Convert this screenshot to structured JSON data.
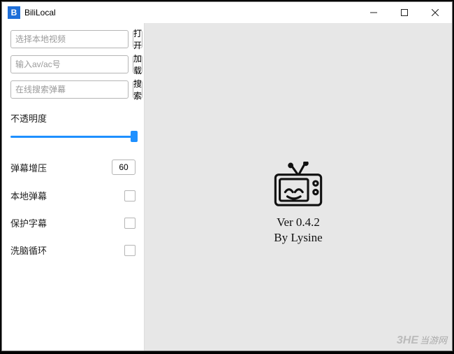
{
  "window": {
    "title": "BiliLocal",
    "app_icon_letter": "B"
  },
  "sidebar": {
    "video_input_placeholder": "选择本地视频",
    "open_label": "打开",
    "avac_input_placeholder": "输入av/ac号",
    "load_label": "加载",
    "search_input_placeholder": "在线搜索弹幕",
    "search_label": "搜索",
    "opacity_label": "不透明度",
    "boost_label": "弹幕增压",
    "boost_value": "60",
    "local_danmaku_label": "本地弹幕",
    "protect_subtitle_label": "保护字幕",
    "brainwash_loop_label": "洗脑循环"
  },
  "content": {
    "version_line1": "Ver 0.4.2",
    "version_line2": "By Lysine"
  },
  "watermark": {
    "brand": "3HE",
    "site": "当游网"
  }
}
